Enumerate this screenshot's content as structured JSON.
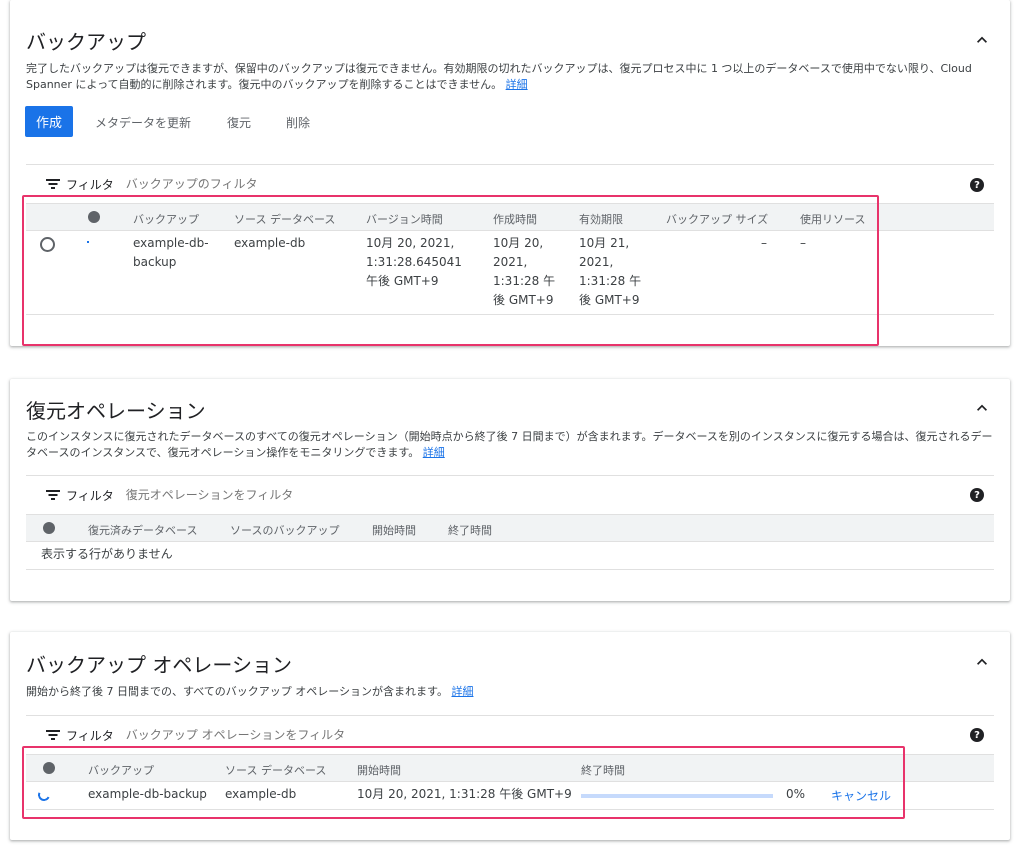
{
  "backups": {
    "title": "バックアップ",
    "desc": "完了したバックアップは復元できますが、保留中のバックアップは復元できません。有効期限の切れたバックアップは、復元プロセス中に 1 つ以上のデータベースで使用中でない限り、Cloud Spanner によって自動的に削除されます。復元中のバックアップを削除することはできません。",
    "desc_link": "詳細",
    "buttons": {
      "create": "作成",
      "update_metadata": "メタデータを更新",
      "restore": "復元",
      "delete": "削除"
    },
    "filter_label": "フィルタ",
    "filter_placeholder": "バックアップのフィルタ",
    "columns": [
      "バックアップ",
      "ソース データベース",
      "バージョン時間",
      "作成時間",
      "有効期限",
      "バックアップ サイズ",
      "使用リソース"
    ],
    "row": {
      "backup": [
        "example-db-",
        "backup"
      ],
      "source_db": "example-db",
      "version_time": [
        "10月 20, 2021,",
        "1:31:28.645041",
        "午後 GMT+9"
      ],
      "create_time": [
        "10月 20,",
        "2021,",
        "1:31:28 午",
        "後 GMT+9"
      ],
      "expire_time": [
        "10月 21,",
        "2021,",
        "1:31:28 午",
        "後 GMT+9"
      ],
      "size": "–",
      "resources": "–"
    }
  },
  "restore_ops": {
    "title": "復元オペレーション",
    "desc": "このインスタンスに復元されたデータベースのすべての復元オペレーション（開始時点から終了後 7 日間まで）が含まれます。データベースを別のインスタンスに復元する場合は、復元されるデータベースのインスタンスで、復元オペレーション操作をモニタリングできます。",
    "desc_link": "詳細",
    "filter_label": "フィルタ",
    "filter_placeholder": "復元オペレーションをフィルタ",
    "columns": [
      "復元済みデータベース",
      "ソースのバックアップ",
      "開始時間",
      "終了時間"
    ],
    "empty": "表示する行がありません"
  },
  "backup_ops": {
    "title": "バックアップ オペレーション",
    "desc": "開始から終了後 7 日間までの、すべてのバックアップ オペレーションが含まれます。",
    "desc_link": "詳細",
    "filter_label": "フィルタ",
    "filter_placeholder": "バックアップ オペレーションをフィルタ",
    "columns": [
      "バックアップ",
      "ソース データベース",
      "開始時間",
      "終了時間"
    ],
    "row": {
      "backup": "example-db-backup",
      "source_db": "example-db",
      "start_time": "10月 20, 2021, 1:31:28 午後 GMT+9",
      "progress_label": "0%",
      "progress_value": 0,
      "cancel": "キャンセル"
    }
  },
  "colors": {
    "accent": "#1a73e8",
    "highlight": "#e8336b",
    "header_bg": "#f1f3f4"
  },
  "icons": [
    "chevron-up-icon",
    "filter-icon",
    "help-icon",
    "status-icon",
    "radio-icon",
    "spinner-icon"
  ]
}
